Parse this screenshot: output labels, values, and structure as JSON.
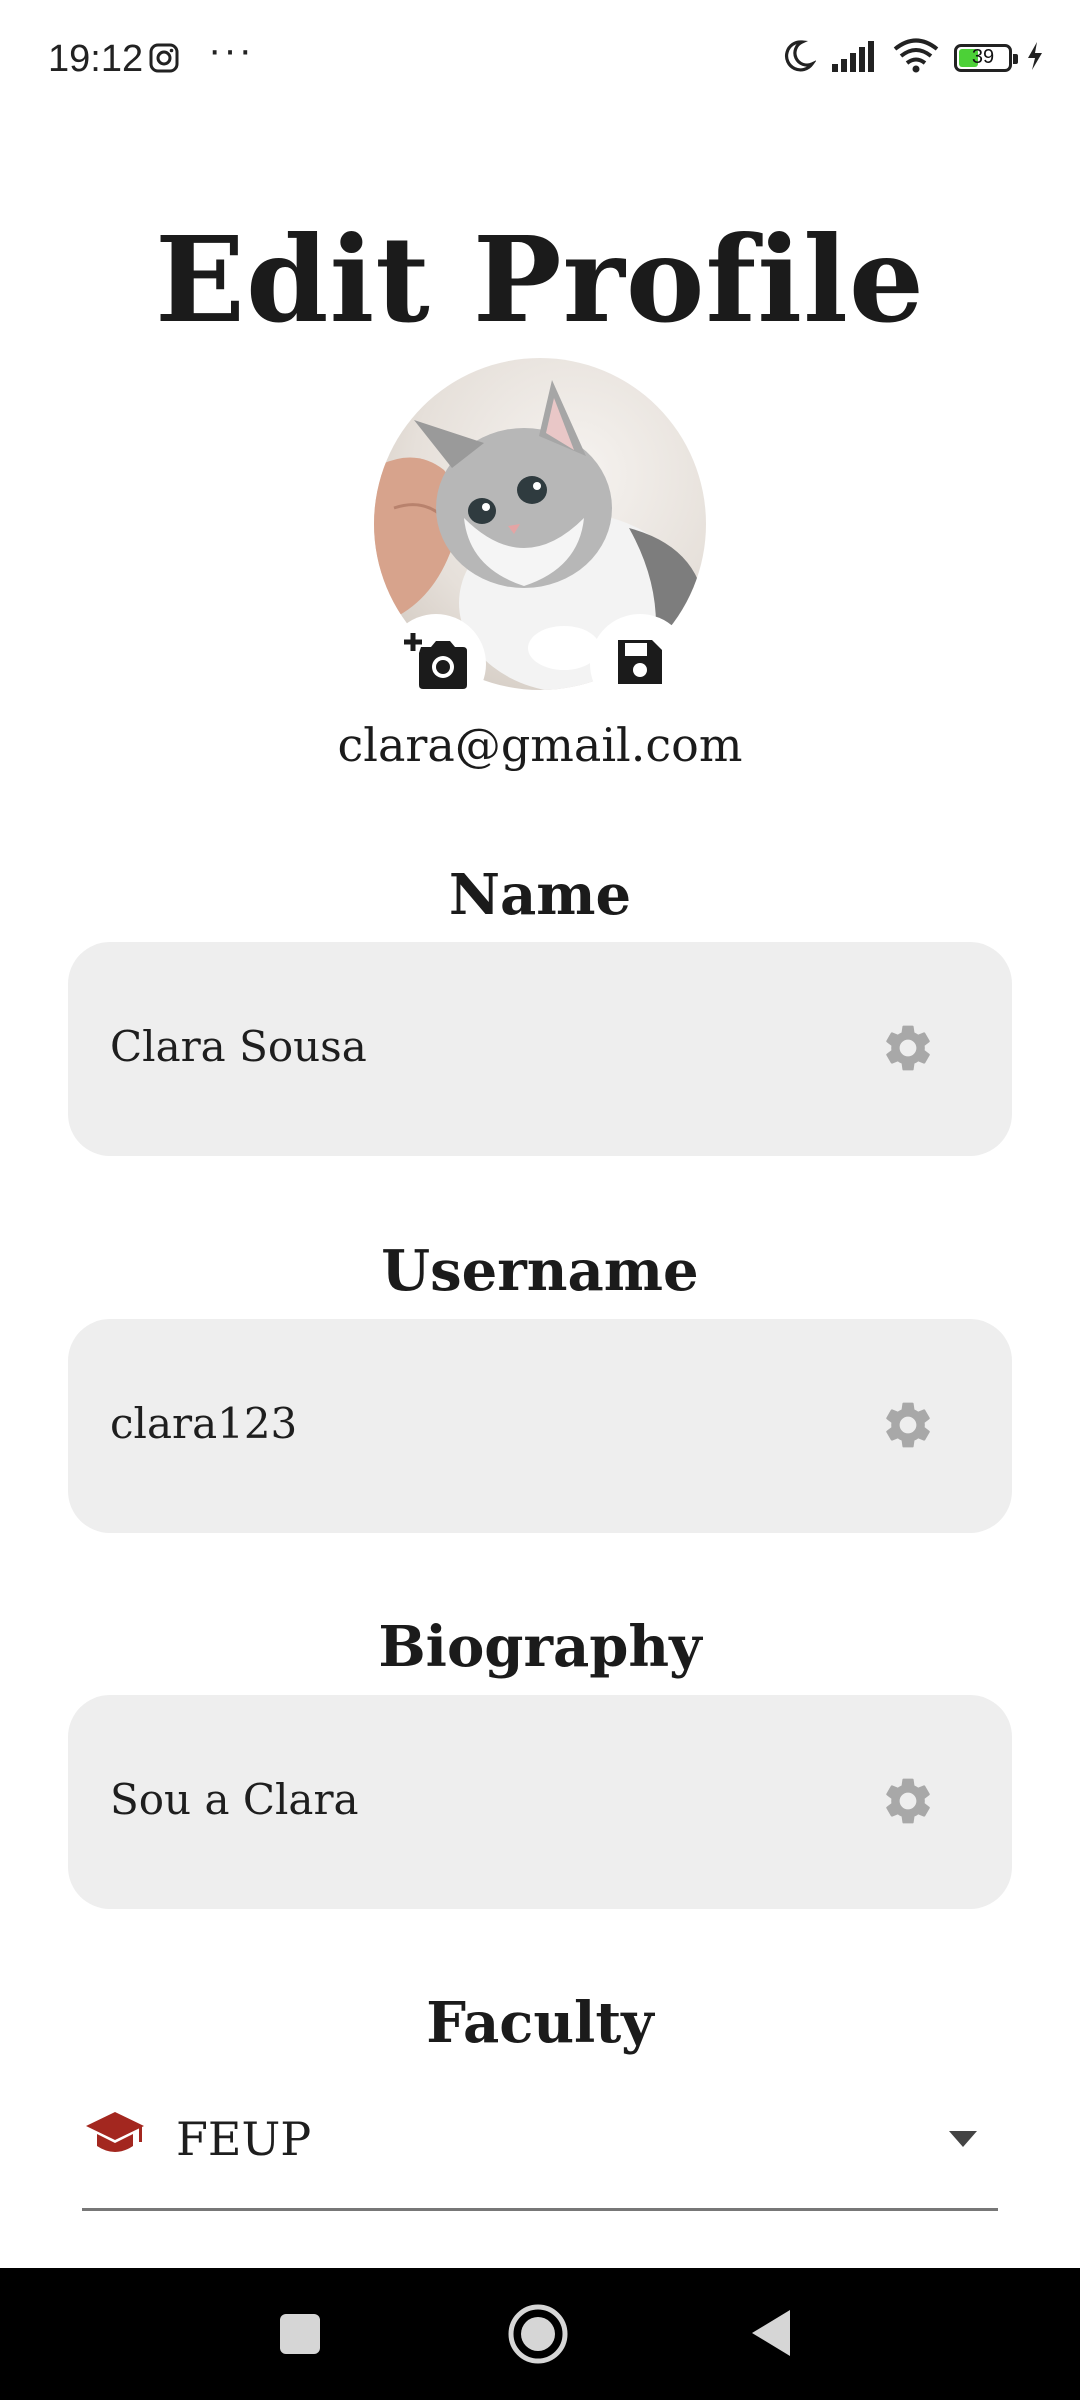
{
  "status_bar": {
    "time": "19:12",
    "dots": "···",
    "battery_level": "39",
    "icons": [
      "instagram-icon",
      "moon-icon",
      "signal-icon",
      "wifi-icon",
      "battery-icon",
      "charging-icon"
    ]
  },
  "page": {
    "title": "Edit Profile",
    "email": "clara@gmail.com"
  },
  "avatar": {
    "description_icons": [
      "add-photo-icon",
      "save-icon"
    ]
  },
  "fields": {
    "name": {
      "label": "Name",
      "value": "Clara Sousa"
    },
    "username": {
      "label": "Username",
      "value": "clara123"
    },
    "biography": {
      "label": "Biography",
      "value": "Sou a Clara"
    }
  },
  "faculty": {
    "label": "Faculty",
    "selected": "FEUP"
  },
  "colors": {
    "field_bg": "#eeeeee",
    "gear": "#a8a8a8",
    "faculty_icon": "#a3271f",
    "battery_fill": "#4cd137"
  }
}
